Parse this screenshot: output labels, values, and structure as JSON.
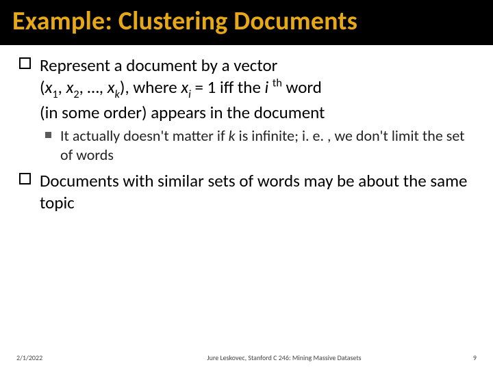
{
  "title": "Example: Clustering Documents",
  "bullets": [
    {
      "prefix": "Represent",
      "rest_line1": " a document by a vector",
      "line2_pre": "(",
      "line2_x1": "x",
      "line2_s1": "1",
      "line2_c1": ", ",
      "line2_x2": "x",
      "line2_s2": "2",
      "line2_c2": ", …, ",
      "line2_xk": "x",
      "line2_sk": "k",
      "line2_mid": "), where ",
      "line2_xi": "x",
      "line2_si": "i",
      "line2_eq": " = 1 iff the ",
      "line2_ivar": "i ",
      "line2_th": "th",
      "line2_end": " word",
      "line3": "(in some order) appears in the document",
      "sub": {
        "pre": "It actually doesn't matter if ",
        "kvar": "k",
        "post": " is infinite; i. e. , we don't limit the set of words"
      }
    },
    {
      "prefix": "Documents",
      "rest": " with similar sets of words may be about the same topic"
    }
  ],
  "footer": {
    "date": "2/1/2022",
    "mid": "Jure Leskovec, Stanford C 246: Mining Massive Datasets",
    "num": "9"
  }
}
